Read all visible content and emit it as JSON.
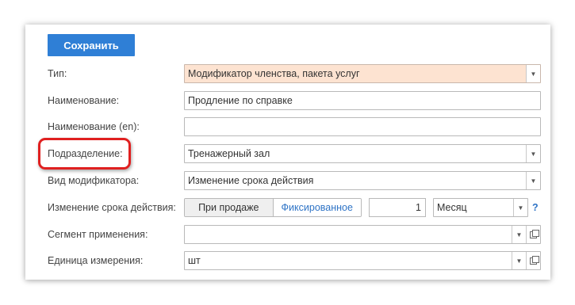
{
  "toolbar": {
    "save_label": "Сохранить"
  },
  "fields": {
    "type": {
      "label": "Тип:",
      "value": "Модификатор членства, пакета услуг"
    },
    "name": {
      "label": "Наименование:",
      "value": "Продление по справке"
    },
    "name_en": {
      "label": "Наименование (en):",
      "value": ""
    },
    "division": {
      "label": "Подразделение:",
      "value": "Тренажерный зал"
    },
    "modifier_kind": {
      "label": "Вид модификатора:",
      "value": "Изменение срока действия"
    },
    "term_change": {
      "label": "Изменение срока действия:",
      "options": [
        "При продаже",
        "Фиксированное"
      ],
      "selected": "При продаже",
      "amount": "1",
      "unit": "Месяц",
      "help": "?"
    },
    "segment": {
      "label": "Сегмент применения:",
      "value": ""
    },
    "unit_measure": {
      "label": "Единица измерения:",
      "value": "шт"
    }
  },
  "icons": {
    "dropdown": "chevron-down-icon",
    "open": "open-form-icon"
  },
  "colors": {
    "save_button": "#2f7fd6",
    "type_field_bg": "#fde3d1",
    "highlight": "#e02020",
    "link": "#2f74c6"
  }
}
